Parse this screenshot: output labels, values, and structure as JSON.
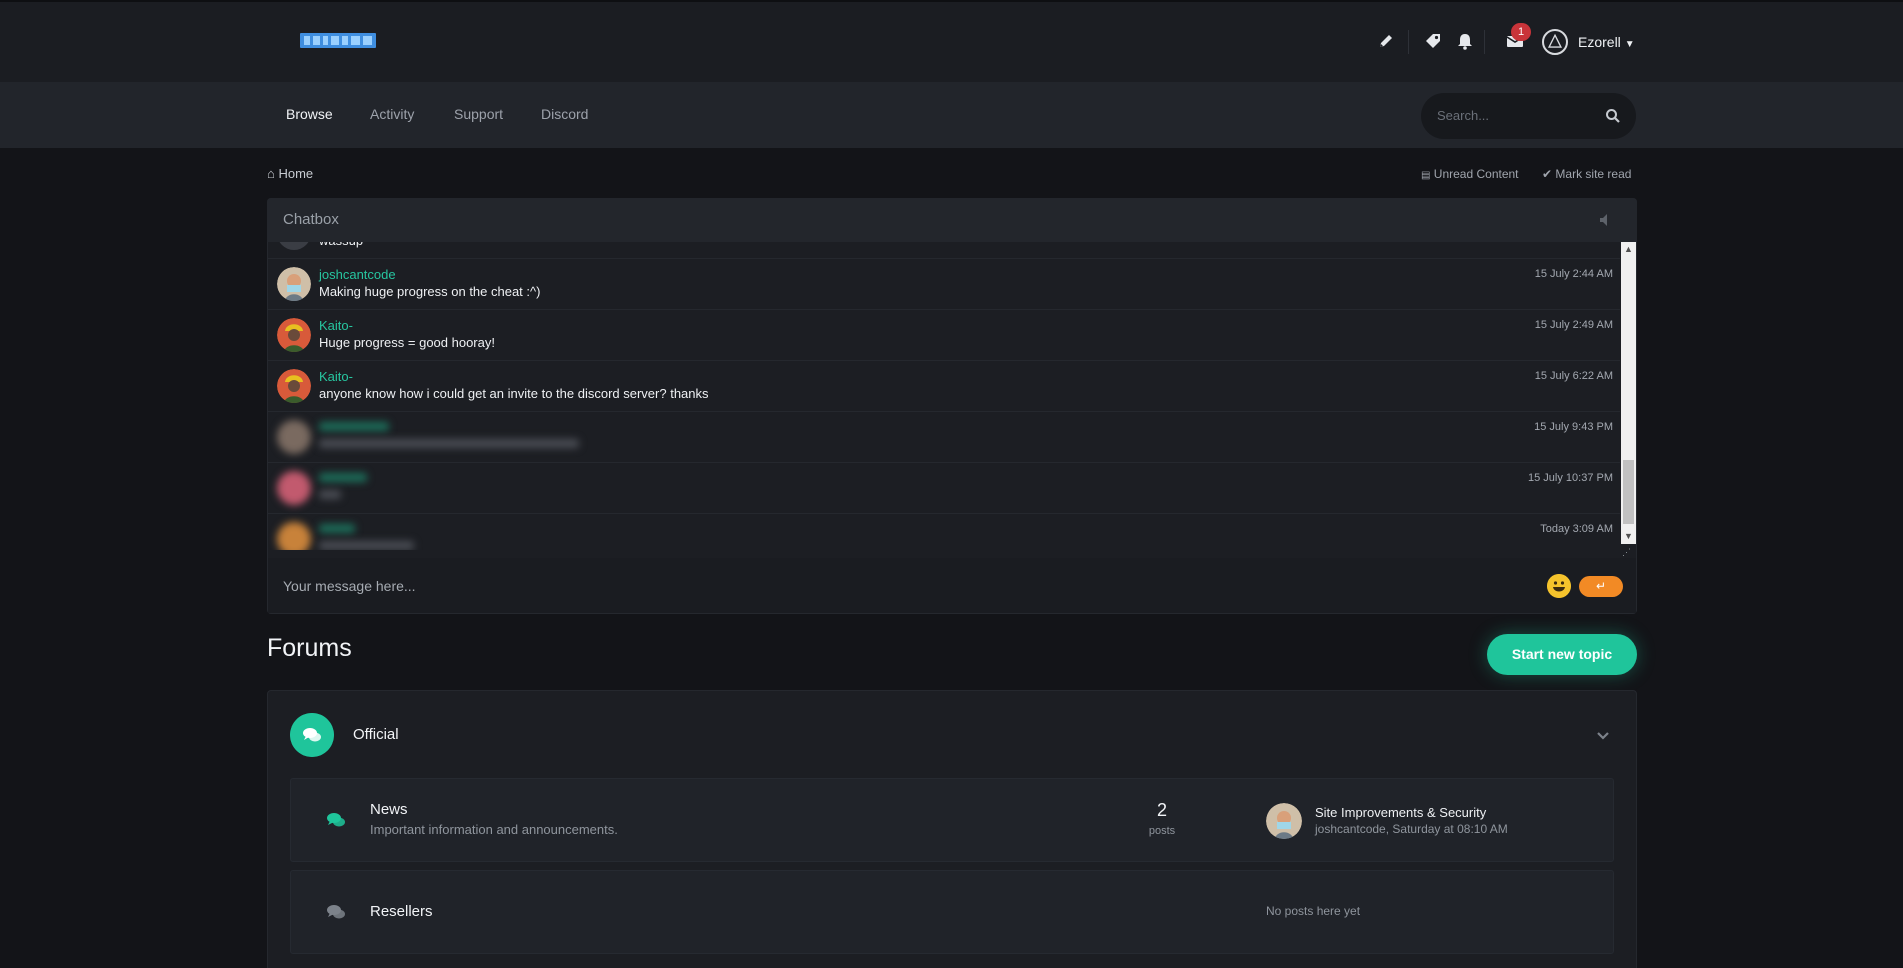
{
  "header": {
    "username": "Ezorell",
    "notification_count": "1",
    "icons": [
      "pencil-icon",
      "tag-icon",
      "bell-icon",
      "envelope-icon",
      "user-avatar-icon"
    ]
  },
  "nav": {
    "items": [
      {
        "label": "Browse",
        "active": true
      },
      {
        "label": "Activity",
        "active": false
      },
      {
        "label": "Support",
        "active": false
      },
      {
        "label": "Discord",
        "active": false
      }
    ],
    "search_placeholder": "Search..."
  },
  "breadcrumb": {
    "home": "Home",
    "unread_content": "Unread Content",
    "mark_site_read": "Mark site read"
  },
  "chatbox": {
    "title": "Chatbox",
    "partial_text": "wassup",
    "messages": [
      {
        "user": "joshcantcode",
        "text": "Making huge progress on the cheat :^)",
        "time": "15 July 2:44 AM"
      },
      {
        "user": "Kaito-",
        "text": "Huge progress = good hooray!",
        "time": "15 July 2:49 AM"
      },
      {
        "user": "Kaito-",
        "text": "anyone know how i could get an invite to the discord server? thanks",
        "time": "15 July 6:22 AM"
      },
      {
        "user": "",
        "text": "",
        "time": "15 July 9:43 PM"
      },
      {
        "user": "",
        "text": "",
        "time": "15 July 10:37 PM"
      },
      {
        "user": "",
        "text": "",
        "time": "Today 3:09 AM"
      }
    ],
    "input_placeholder": "Your message here...",
    "send_label": "↵"
  },
  "forums": {
    "title": "Forums",
    "new_topic_label": "Start new topic",
    "category": {
      "name": "Official",
      "forums": [
        {
          "name": "News",
          "description": "Important information and announcements.",
          "post_count": "2",
          "post_count_label": "posts",
          "last_post_title": "Site Improvements & Security",
          "last_post_meta": "joshcantcode, Saturday at 08:10 AM"
        },
        {
          "name": "Resellers",
          "description": "",
          "empty_label": "No posts here yet"
        }
      ]
    }
  },
  "colors": {
    "accent": "#1fc59b",
    "username": "#27c6a0",
    "send": "#f28a25",
    "badge": "#c9343a"
  }
}
